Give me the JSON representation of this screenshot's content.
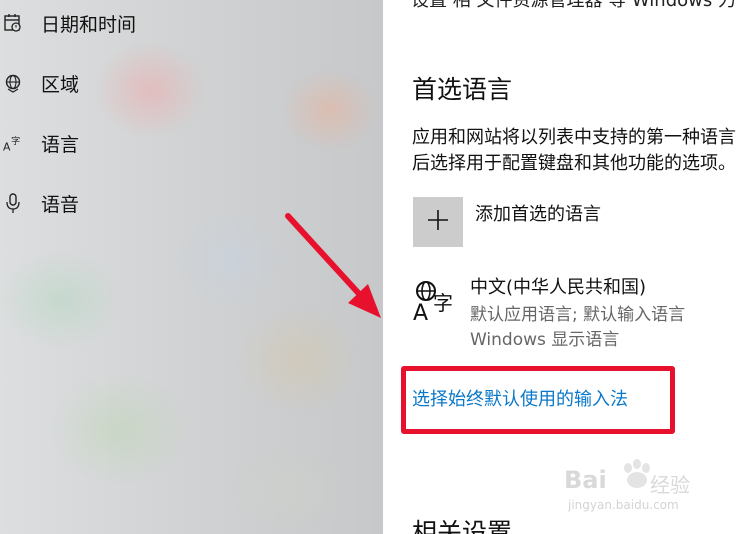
{
  "sidebar": {
    "items": [
      {
        "label": "日期和时间",
        "icon": "calendar-clock-icon"
      },
      {
        "label": "区域",
        "icon": "globe-region-icon"
      },
      {
        "label": "语言",
        "icon": "language-icon"
      },
      {
        "label": "语音",
        "icon": "microphone-icon"
      }
    ]
  },
  "main": {
    "top_cut_text": "设置 相 文件资源管理器 等 Windows 力",
    "section_title": "首选语言",
    "description_line1": "应用和网站将以列表中支持的第一种语言",
    "description_line2": "后选择用于配置键盘和其他功能的选项。",
    "add_language_label": "添加首选的语言",
    "language": {
      "name": "中文(中华人民共和国)",
      "detail1": "默认应用语言; 默认输入语言",
      "detail2": "Windows 显示语言"
    },
    "input_method_link": "选择始终默认使用的输入法",
    "related_settings_title": "相关设置"
  },
  "annotation": {
    "arrow_color": "#e8112d",
    "box_color": "#e8112d"
  },
  "watermark": {
    "brand": "Bai",
    "brand_suffix": "经验",
    "url": "jingyan.baidu.com"
  }
}
